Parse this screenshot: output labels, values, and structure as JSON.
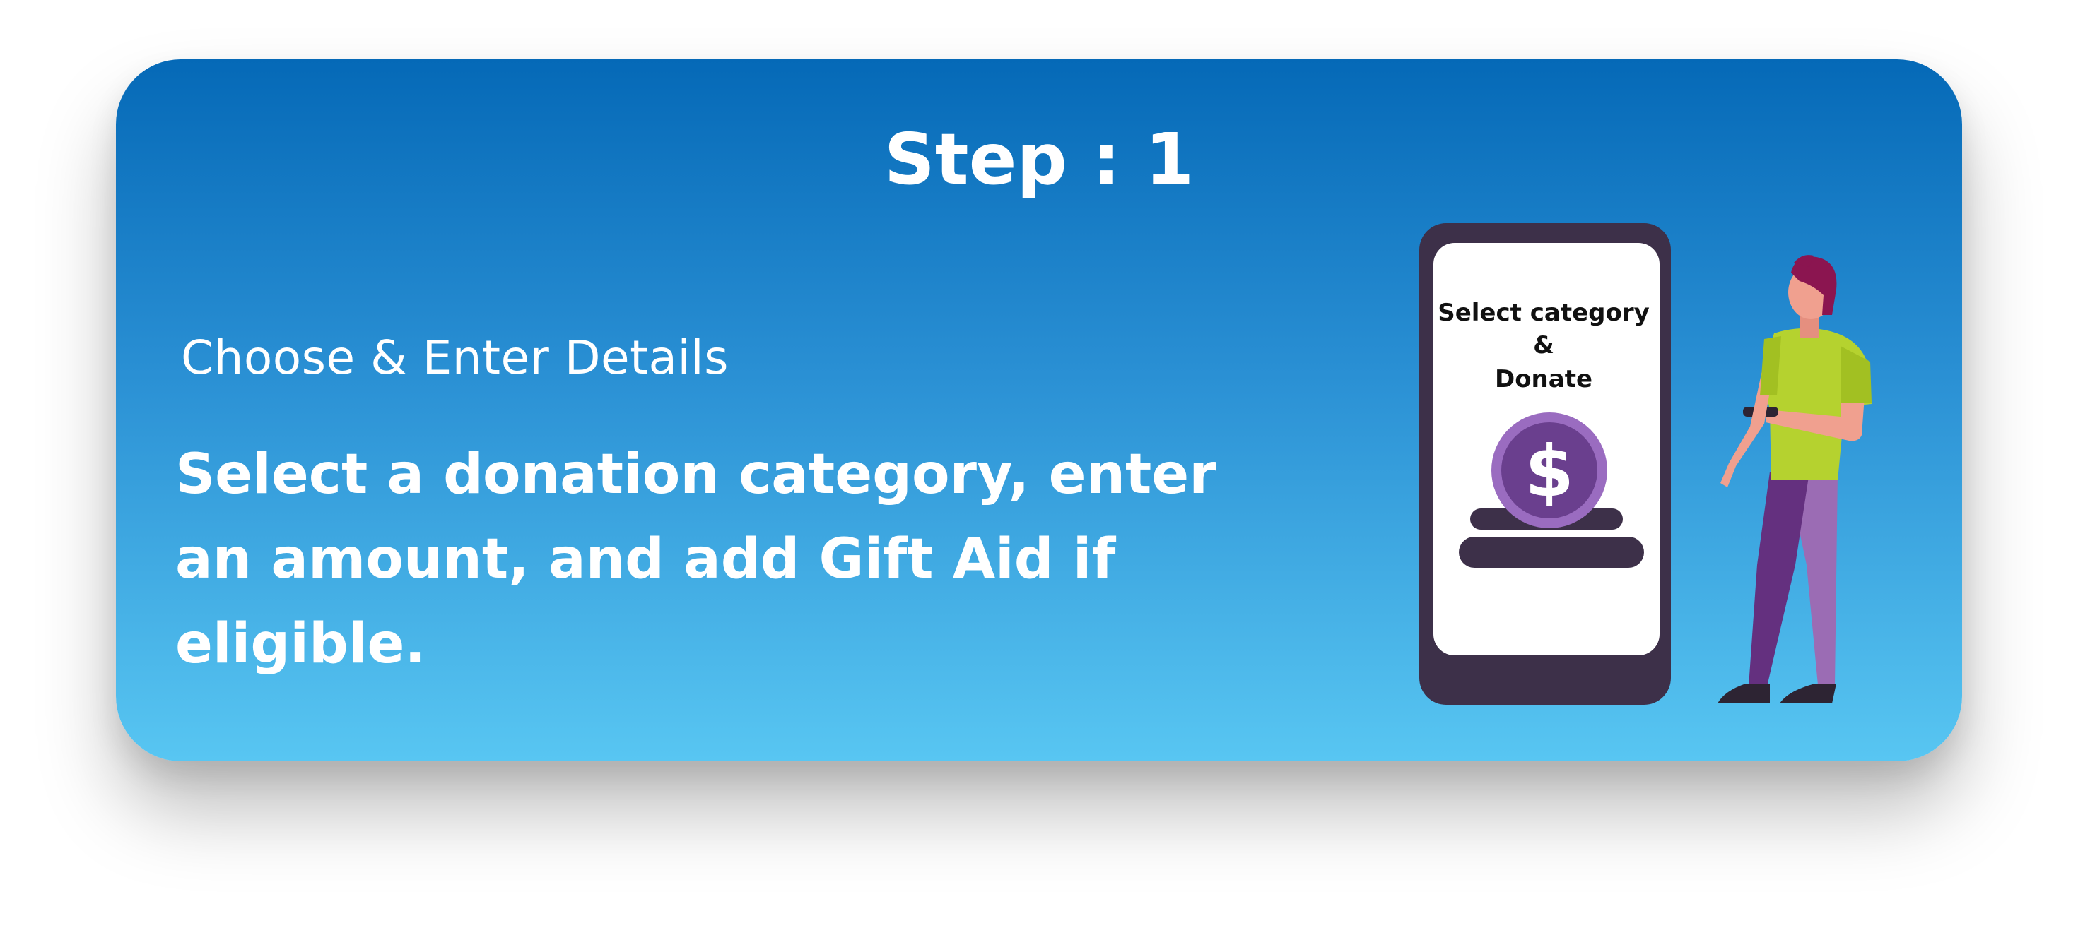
{
  "step": {
    "title": "Step : 1",
    "subtitle": "Choose & Enter Details",
    "description": "Select a donation category, enter an amount, and add Gift Aid if eligible."
  },
  "illustration": {
    "phone_line1": "Select category",
    "phone_line2": "&",
    "phone_line3": "Donate",
    "coin_symbol": "$"
  },
  "colors": {
    "gradient_top": "#0569b7",
    "gradient_bottom": "#58c6f2",
    "phone_frame": "#3d3049",
    "coin": "#6a3f8e",
    "shirt": "#b5d22f",
    "pants": "#64307f",
    "hair": "#8b1550"
  },
  "icons": [
    "dollar-coin-icon",
    "person-illustration",
    "phone-illustration"
  ]
}
